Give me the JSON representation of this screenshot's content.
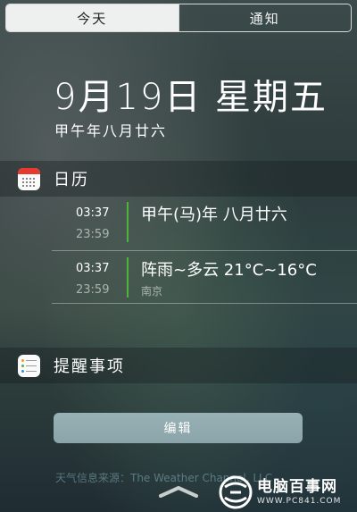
{
  "tabs": [
    {
      "label": "今天",
      "active": true
    },
    {
      "label": "通知",
      "active": false
    }
  ],
  "header": {
    "date": "9月19日 星期五",
    "lunar_date": "甲午年八月廿六"
  },
  "calendar": {
    "title": "日历",
    "icon": "calendar-icon",
    "events": [
      {
        "start": "03:37",
        "end": "23:59",
        "title": "甲午(马)年 八月廿六",
        "subtitle": ""
      },
      {
        "start": "03:37",
        "end": "23:59",
        "title": "阵雨~多云 21°C~16°C",
        "subtitle": "南京"
      }
    ]
  },
  "reminders": {
    "title": "提醒事项",
    "icon": "reminders-icon"
  },
  "edit_button": "编辑",
  "footer_text": "天气信息来源：The Weather Channel, LLC",
  "handle_icon": "chevron-up-icon",
  "watermark": {
    "name": "电脑百事网",
    "url": "WWW.PC841.COM"
  },
  "colors": {
    "accent_green": "#4fb53a",
    "calendar_red": "#e8392f",
    "button_bg": "#8fa9ad"
  }
}
